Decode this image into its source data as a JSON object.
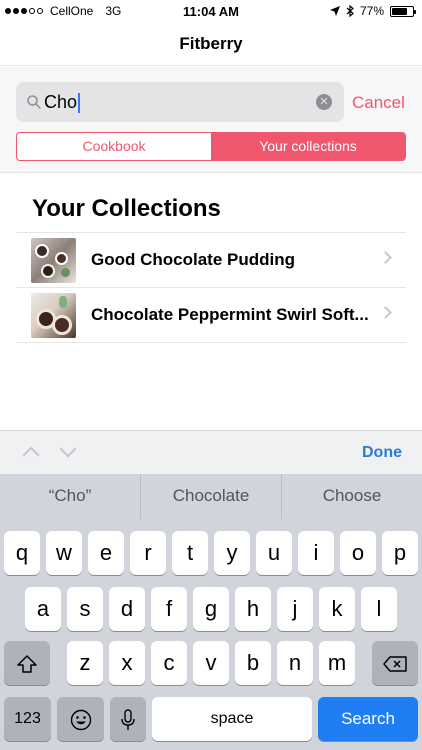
{
  "status_bar": {
    "carrier": "CellOne",
    "network": "3G",
    "time": "11:04 AM",
    "battery": "77%",
    "battery_level": 0.77
  },
  "nav": {
    "title": "Fitberry"
  },
  "search": {
    "query": "Cho",
    "cancel_label": "Cancel",
    "segments": [
      {
        "label": "Cookbook",
        "active": false
      },
      {
        "label": "Your collections",
        "active": true
      }
    ]
  },
  "collections": {
    "title": "Your Collections",
    "items": [
      {
        "label": "Good Chocolate Pudding"
      },
      {
        "label": "Chocolate Peppermint Swirl Soft..."
      }
    ]
  },
  "accessory": {
    "done_label": "Done"
  },
  "suggestions": [
    "“Cho”",
    "Chocolate",
    "Choose"
  ],
  "keyboard": {
    "row1": [
      "q",
      "w",
      "e",
      "r",
      "t",
      "y",
      "u",
      "i",
      "o",
      "p"
    ],
    "row2": [
      "a",
      "s",
      "d",
      "f",
      "g",
      "h",
      "j",
      "k",
      "l"
    ],
    "row3": [
      "z",
      "x",
      "c",
      "v",
      "b",
      "n",
      "m"
    ],
    "numbers_label": "123",
    "space_label": "space",
    "search_label": "Search"
  },
  "colors": {
    "accent": "#f0566e",
    "keyboard_blue": "#1f7ef4",
    "done_blue": "#2b7bd6"
  }
}
